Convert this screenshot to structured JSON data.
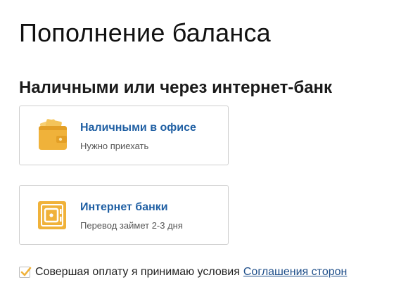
{
  "page": {
    "title": "Пополнение баланса"
  },
  "section": {
    "title": "Наличными или через интернет-банк"
  },
  "options": [
    {
      "name": "Наличными в офисе",
      "description": "Нужно приехать",
      "icon": "wallet-icon"
    },
    {
      "name": "Интернет банки",
      "description": "Перевод займет 2-3 дня",
      "icon": "safe-icon"
    }
  ],
  "agreement": {
    "checked": true,
    "text": "Совершая оплату я принимаю условия",
    "link_text": "Соглашения сторон"
  },
  "colors": {
    "accent_orange": "#f0b23a",
    "link_blue": "#1f5fa3",
    "border": "#cfcfcf"
  }
}
